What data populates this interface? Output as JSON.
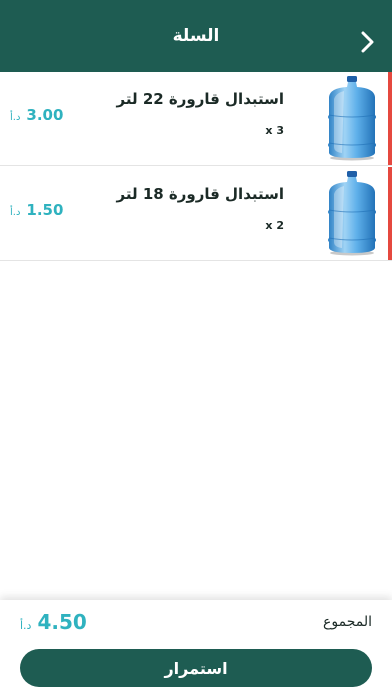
{
  "header": {
    "title": "السلة",
    "back_icon": "chevron-right-icon"
  },
  "cart": {
    "items": [
      {
        "name": "استبدال قارورة 22 لتر",
        "qty": "x 3",
        "currency": "د.أ",
        "price": "3.00",
        "image": "water-bottle-icon"
      },
      {
        "name": "استبدال قارورة 18 لتر",
        "qty": "x 2",
        "currency": "د.أ",
        "price": "1.50",
        "image": "water-bottle-icon"
      }
    ]
  },
  "footer": {
    "total_label": "المجموع",
    "currency": "د.أ",
    "total": "4.50",
    "continue_label": "استمرار"
  },
  "colors": {
    "primary": "#1e5c52",
    "accent": "#2fb2bf",
    "indicator": "#e5483f"
  }
}
